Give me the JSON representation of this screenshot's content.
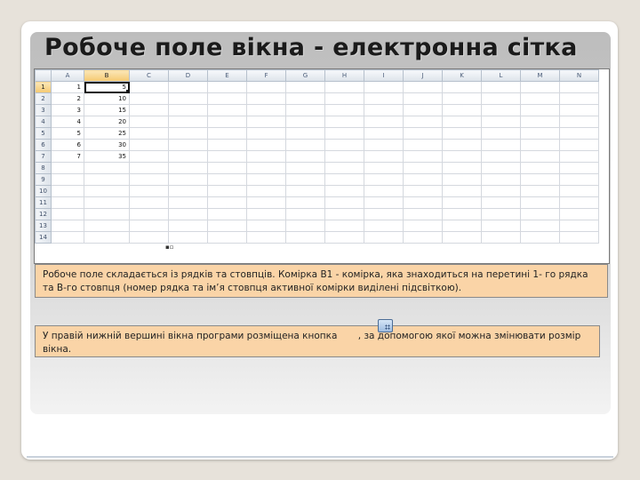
{
  "slide": {
    "title": "Робоче поле вікна - електронна сітка"
  },
  "spreadsheet": {
    "columns": [
      "A",
      "B",
      "C",
      "D",
      "E",
      "F",
      "G",
      "H",
      "I",
      "J",
      "K",
      "L",
      "M",
      "N"
    ],
    "row_numbers": [
      "1",
      "2",
      "3",
      "4",
      "5",
      "6",
      "7",
      "8",
      "9",
      "10",
      "11",
      "12",
      "13",
      "14"
    ],
    "active_cell": "B1",
    "cells": {
      "A": [
        "1",
        "2",
        "3",
        "4",
        "5",
        "6",
        "7"
      ],
      "B": [
        "5",
        "10",
        "15",
        "20",
        "25",
        "30",
        "35"
      ]
    }
  },
  "notes": {
    "note1": "Робоче поле складається із рядків та стовпців. Комірка B1 - комірка, яка знаходиться на перетині 1- го рядка та B-го стовпця (номер рядка та ім’я стовпця активної комірки виділені підсвіткою).",
    "note2_before": "У правій нижній вершині вікна програми розміщена кнопка",
    "note2_after": ", за допомогою якої можна змінювати розмір вікна."
  }
}
